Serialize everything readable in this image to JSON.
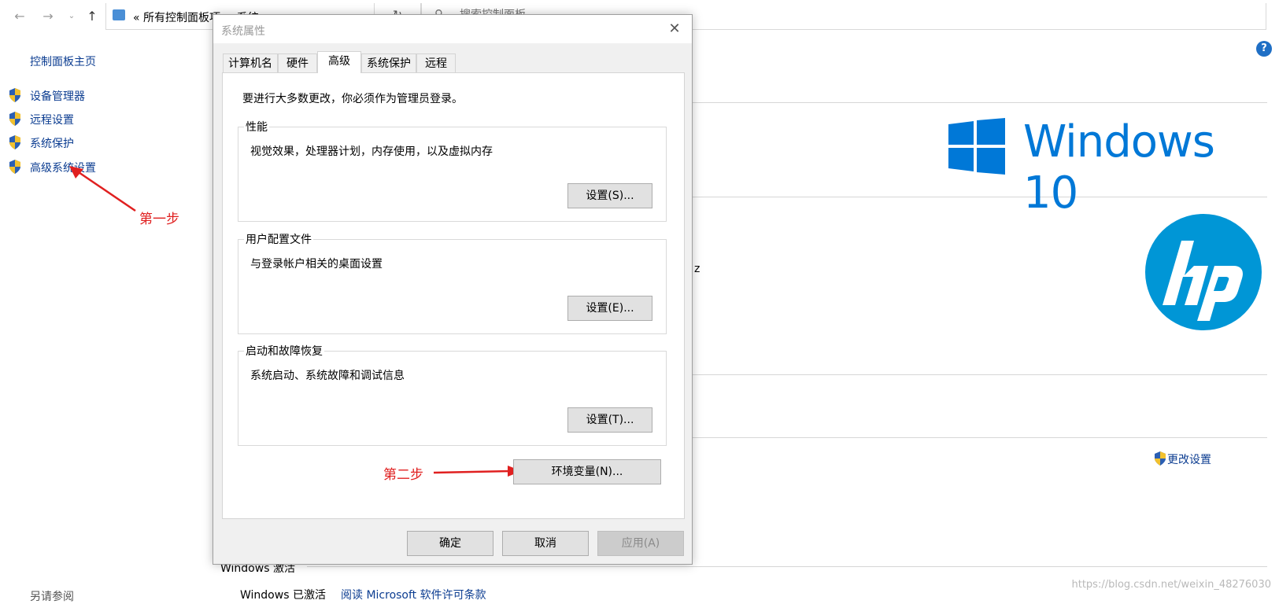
{
  "explorer": {
    "back_icon": "back-arrow-icon",
    "address_path": "«  所有控制面板项  >  系统",
    "search_placeholder": "搜索控制面板"
  },
  "left_pane": {
    "home_link": "控制面板主页",
    "items": [
      "设备管理器",
      "远程设置",
      "系统保护",
      "高级系统设置"
    ],
    "see_also": "另请参阅"
  },
  "background": {
    "windows_logo_text": "Windows 10",
    "partial_text_z": "z",
    "change_settings": "更改设置",
    "activation_title": "Windows 激活",
    "activation_status": "Windows 已激活",
    "license_link": "阅读 Microsoft 软件许可条款"
  },
  "dialog": {
    "title": "系统属性",
    "tabs": [
      "计算机名",
      "硬件",
      "高级",
      "系统保护",
      "远程"
    ],
    "active_tab": "高级",
    "admin_note": "要进行大多数更改，你必须作为管理员登录。",
    "groups": [
      {
        "title": "性能",
        "desc": "视觉效果，处理器计划，内存使用，以及虚拟内存",
        "button": "设置(S)..."
      },
      {
        "title": "用户配置文件",
        "desc": "与登录帐户相关的桌面设置",
        "button": "设置(E)..."
      },
      {
        "title": "启动和故障恢复",
        "desc": "系统启动、系统故障和调试信息",
        "button": "设置(T)..."
      }
    ],
    "env_button": "环境变量(N)...",
    "ok": "确定",
    "cancel": "取消",
    "apply": "应用(A)"
  },
  "annotations": {
    "step1": "第一步",
    "step2": "第二步"
  },
  "watermark": "https://blog.csdn.net/weixin_48276030",
  "colors": {
    "link": "#0c3d91",
    "annotation": "#e02020",
    "windows_blue": "#0078d7",
    "hp_blue": "#0096d6"
  }
}
